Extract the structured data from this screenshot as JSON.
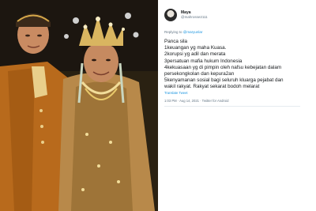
{
  "tweet": {
    "display_name": "Maya",
    "handle": "@mahrosse2111",
    "reply_prefix": "Replying to ",
    "reply_mention": "@maryunlar",
    "lines": [
      "Panca sila",
      "1keuangan yg maha Kuasa.",
      "2korupsi yg adil dan merata",
      "3persatuan mafia hukum Indonesia",
      "4kekuasaan yg di pimpin oleh nafsu kebejatan dalam",
      "persekongkolan dan kepura2an",
      "5kenyamanan sosial bagi seluruh kluarga pejabat dan",
      "wakil rakyat. Rakyat sekarat bodoh melarat"
    ],
    "translate_label": "Translate Tweet",
    "timestamp": "1:03 PM · Aug 14, 2021 · Twitter for Android"
  },
  "colors": {
    "link": "#1b95e0",
    "muted": "#657786",
    "text": "#14171a"
  }
}
